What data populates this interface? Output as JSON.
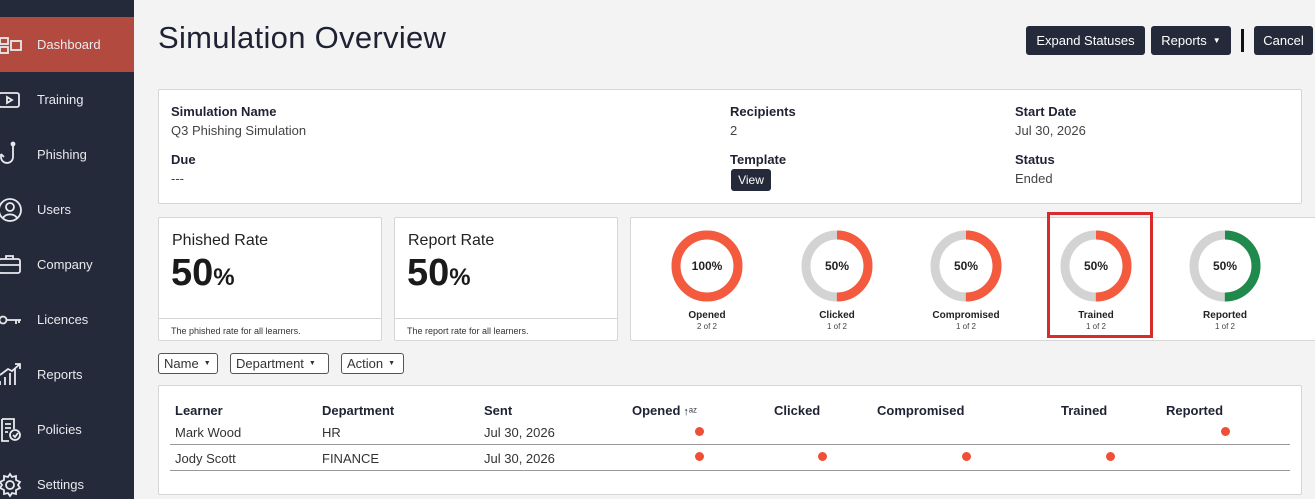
{
  "sidebar": {
    "items": [
      {
        "label": "Dashboard",
        "icon": "dashboard-icon",
        "active": true
      },
      {
        "label": "Training",
        "icon": "training-icon",
        "active": false
      },
      {
        "label": "Phishing",
        "icon": "phishing-hook-icon",
        "active": false
      },
      {
        "label": "Users",
        "icon": "user-icon",
        "active": false
      },
      {
        "label": "Company",
        "icon": "briefcase-icon",
        "active": false
      },
      {
        "label": "Licences",
        "icon": "key-icon",
        "active": false
      },
      {
        "label": "Reports",
        "icon": "chart-icon",
        "active": false
      },
      {
        "label": "Policies",
        "icon": "policy-icon",
        "active": false
      },
      {
        "label": "Settings",
        "icon": "gear-icon",
        "active": false
      }
    ]
  },
  "header": {
    "title": "Simulation Overview",
    "expand_label": "Expand Statuses",
    "reports_label": "Reports",
    "cancel_label": "Cancel"
  },
  "info": {
    "name_label": "Simulation Name",
    "name_value": "Q3 Phishing Simulation",
    "recipients_label": "Recipients",
    "recipients_value": "2",
    "start_label": "Start Date",
    "start_value": "Jul 30, 2026",
    "due_label": "Due",
    "due_value": "---",
    "template_label": "Template",
    "template_button": "View",
    "status_label": "Status",
    "status_value": "Ended"
  },
  "rates": {
    "phished": {
      "title": "Phished Rate",
      "value": "50",
      "unit": "%",
      "footnote": "The phished rate for all learners."
    },
    "report": {
      "title": "Report Rate",
      "value": "50",
      "unit": "%",
      "footnote": "The report rate for all learners."
    }
  },
  "donuts": [
    {
      "label": "Opened",
      "percent_text": "100%",
      "fraction": 1.0,
      "sub": "2 of 2",
      "color": "#f45a3d"
    },
    {
      "label": "Clicked",
      "percent_text": "50%",
      "fraction": 0.5,
      "sub": "1 of 2",
      "color": "#f45a3d"
    },
    {
      "label": "Compromised",
      "percent_text": "50%",
      "fraction": 0.5,
      "sub": "1 of 2",
      "color": "#f45a3d"
    },
    {
      "label": "Trained",
      "percent_text": "50%",
      "fraction": 0.5,
      "sub": "1 of 2",
      "color": "#f45a3d"
    },
    {
      "label": "Reported",
      "percent_text": "50%",
      "fraction": 0.5,
      "sub": "1 of 2",
      "color": "#1f8a4c"
    }
  ],
  "colors": {
    "track": "#d3d3d3",
    "dot": "#f04e37",
    "highlight": "#d92b2b"
  },
  "filters": [
    "Name",
    "Department",
    "Action"
  ],
  "table": {
    "headers": {
      "learner": "Learner",
      "department": "Department",
      "sent": "Sent",
      "opened": "Opened",
      "clicked": "Clicked",
      "compromised": "Compromised",
      "trained": "Trained",
      "reported": "Reported"
    },
    "sort_icon": "sort-az-icon",
    "rows": [
      {
        "learner": "Mark Wood",
        "department": "HR",
        "sent": "Jul 30, 2026",
        "opened": true,
        "clicked": false,
        "compromised": false,
        "trained": false,
        "reported": true
      },
      {
        "learner": "Jody Scott",
        "department": "FINANCE",
        "sent": "Jul 30, 2026",
        "opened": true,
        "clicked": true,
        "compromised": true,
        "trained": true,
        "reported": false
      }
    ]
  }
}
